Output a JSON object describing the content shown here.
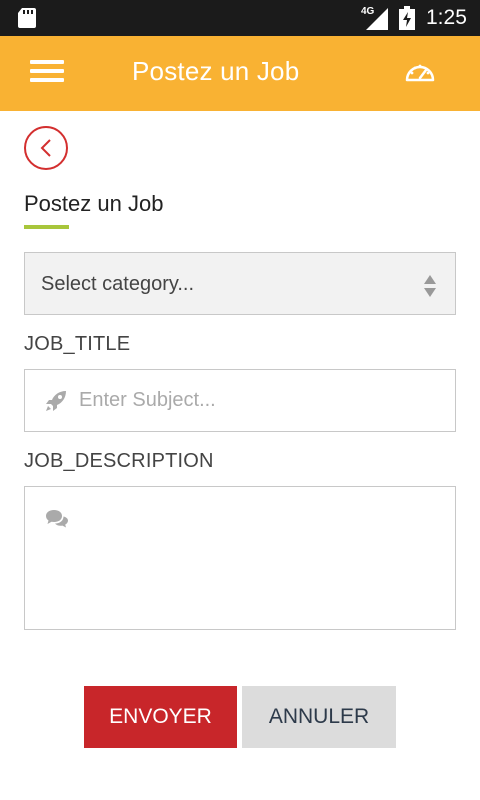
{
  "status_bar": {
    "network": "4G",
    "time": "1:25",
    "icons": [
      "sd-card-icon",
      "signal-icon",
      "battery-charging-icon"
    ]
  },
  "app_bar": {
    "title": "Postez un Job",
    "icons": [
      "menu-icon",
      "dashboard-gauge-icon"
    ]
  },
  "page": {
    "heading": "Postez un Job"
  },
  "form": {
    "category_select": {
      "selected": "Select category..."
    },
    "job_title": {
      "label": "JOB_TITLE",
      "placeholder": "Enter Subject...",
      "value": ""
    },
    "job_description": {
      "label": "JOB_DESCRIPTION",
      "value": ""
    }
  },
  "actions": {
    "submit_label": "ENVOYER",
    "cancel_label": "ANNULER"
  },
  "colors": {
    "status_bar": "#1b1b1b",
    "app_bar": "#f9b233",
    "accent_underline": "#a8c63b",
    "back_ring": "#d32f2f",
    "submit": "#c8262a",
    "cancel": "#dcdcdc"
  }
}
